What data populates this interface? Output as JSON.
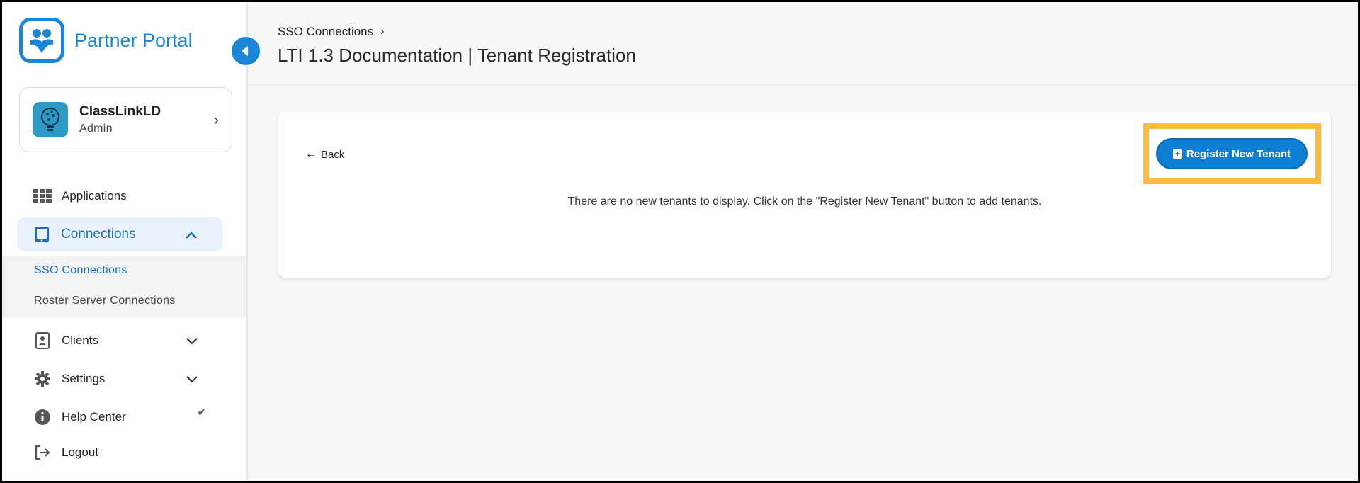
{
  "brand": {
    "name": "Partner Portal",
    "logo_icon": "partner-logo-icon",
    "color": "#1b86d8"
  },
  "account": {
    "name": "ClassLinkLD",
    "role": "Admin",
    "chevron": "›"
  },
  "sidebar": {
    "items": [
      {
        "label": "Applications",
        "icon": "grid-icon"
      },
      {
        "label": "Connections",
        "icon": "tablet-icon",
        "chevron": "︿"
      },
      {
        "label": "Clients",
        "icon": "contacts-book-icon",
        "chevron": "⌄"
      },
      {
        "label": "Settings",
        "icon": "gear-icon",
        "chevron": "⌄"
      },
      {
        "label": "Help Center",
        "icon": "info-icon",
        "chevron": "✔"
      },
      {
        "label": "Logout",
        "icon": "logout-icon"
      }
    ],
    "sub_items": [
      {
        "label": "SSO Connections"
      },
      {
        "label": "Roster Server Connections"
      }
    ]
  },
  "header": {
    "breadcrumb": "SSO Connections",
    "breadcrumb_sep": "›",
    "title": "LTI 1.3 Documentation | Tenant Registration"
  },
  "card": {
    "back_label": "Back",
    "back_arrow": "←",
    "register_label": "Register New Tenant",
    "empty_message": "There are no new tenants to display. Click on the \"Register New Tenant\" button to add tenants."
  },
  "colors": {
    "accent": "#0e7fd3",
    "highlight": "#fbbc3f",
    "active_bg": "#e8f1fc"
  }
}
